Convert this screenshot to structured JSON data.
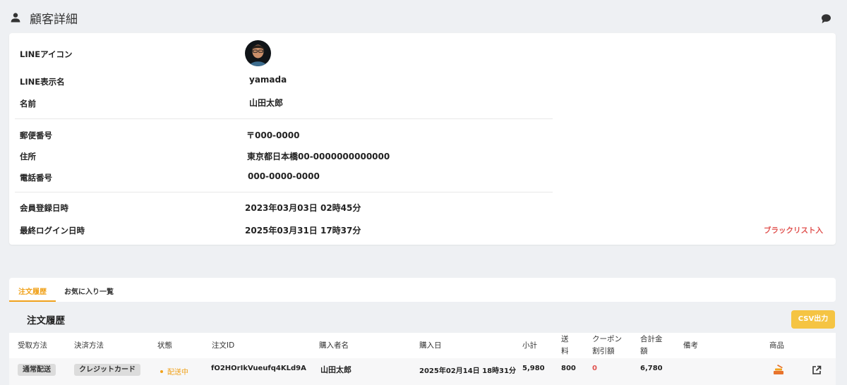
{
  "header": {
    "title": "顧客詳細",
    "icon": "person-icon",
    "right_icon": "chat-icon"
  },
  "profile": {
    "line_icon_label": "LINEアイコン",
    "line_name_label": "LINE表示名",
    "line_name_value": "yamada",
    "name_label": "名前",
    "name_value": "山田太郎",
    "postal_label": "郵便番号",
    "postal_value": "〒000-0000",
    "address_label": "住所",
    "address_value": "東京都日本橋00-0000000000000",
    "phone_label": "電話番号",
    "phone_value": "000-0000-0000",
    "registered_label": "会員登録日時",
    "registered_value": "2023年03月03日 02時45分",
    "last_login_label": "最終ログイン日時",
    "last_login_value": "2025年03月31日 17時37分",
    "blacklist_label": "ブラックリスト入"
  },
  "tabs": [
    {
      "label": "注文履歴",
      "active": true
    },
    {
      "label": "お気に入り一覧",
      "active": false
    }
  ],
  "orders": {
    "title": "注文履歴",
    "csv_label": "CSV出力",
    "columns": {
      "receive": "受取方法",
      "payment": "決済方法",
      "status": "状態",
      "order_id": "注文ID",
      "buyer": "購入者名",
      "date": "購入日",
      "subtotal": "小計",
      "shipping_1": "送",
      "shipping_2": "料",
      "coupon_1": "クーポン",
      "coupon_2": "割引額",
      "total_1": "合計金",
      "total_2": "額",
      "note": "備考",
      "product": "商品"
    },
    "rows": [
      {
        "receive": "通常配送",
        "payment": "クレジットカード",
        "status": "配送中",
        "order_id": "fO2HOrIkVueufq4KLd9A",
        "buyer": "山田太郎",
        "date": "2025年02月14日 18時31分",
        "subtotal": "5,980",
        "shipping": "800",
        "coupon": "0",
        "total": "6,780",
        "note": ""
      }
    ]
  },
  "colors": {
    "accent": "#f0a21c",
    "danger": "#e0524f",
    "csv_button": "#f5c443",
    "background": "#eef0f3"
  }
}
